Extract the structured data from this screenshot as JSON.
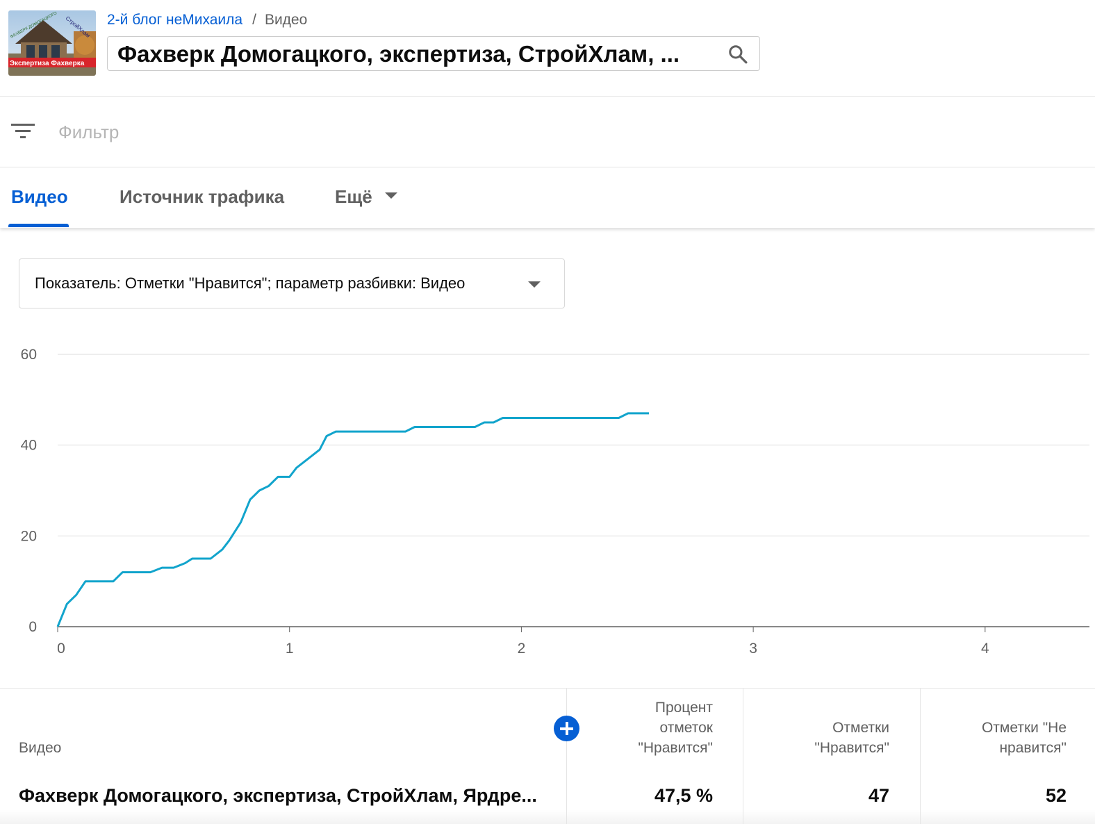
{
  "header": {
    "channel_name": "2-й блог неМихаила",
    "breadcrumb_separator": "/",
    "breadcrumb_current": "Видео",
    "video_title": "Фахверк Домогацкого, экспертиза, СтройХлам, ...",
    "thumbnail": {
      "caption": "Экспертиза Фахверка",
      "logo_text": "СтройХлам",
      "tilted_text": "ФАХВЕРК ДОМОГАЦКОГО"
    }
  },
  "filter": {
    "placeholder": "Фильтр"
  },
  "tabs": {
    "items": [
      {
        "label": "Видео",
        "active": true
      },
      {
        "label": "Источник трафика",
        "active": false
      }
    ],
    "more_label": "Ещё"
  },
  "metric_selector": {
    "label": "Показатель: Отметки \"Нравится\"; параметр разбивки: Видео"
  },
  "chart_data": {
    "type": "line",
    "color": "#12a4cc",
    "x_ticks": [
      "0",
      "1",
      "2",
      "3",
      "4"
    ],
    "y_ticks": [
      "0",
      "20",
      "40",
      "60"
    ],
    "xlim": [
      0,
      4.45
    ],
    "ylim": [
      0,
      60
    ],
    "grid": true,
    "series": [
      {
        "x": [
          0,
          0.04,
          0.08,
          0.12,
          0.24,
          0.28,
          0.4,
          0.45,
          0.5,
          0.55,
          0.58,
          0.66,
          0.71,
          0.74,
          0.79,
          0.83,
          0.87,
          0.91,
          0.95,
          1.0,
          1.03,
          1.08,
          1.13,
          1.16,
          1.2,
          1.5,
          1.54,
          1.8,
          1.84,
          1.88,
          1.92,
          2.42,
          2.46,
          2.55
        ],
        "y": [
          0,
          5,
          7,
          10,
          10,
          12,
          12,
          13,
          13,
          14,
          15,
          15,
          17,
          19,
          23,
          28,
          30,
          31,
          33,
          33,
          35,
          37,
          39,
          42,
          43,
          43,
          44,
          44,
          45,
          45,
          46,
          46,
          47,
          47
        ]
      }
    ]
  },
  "table": {
    "columns": [
      "Видео",
      "Процент отметок \"Нравится\"",
      "Отметки \"Нравится\"",
      "Отметки \"Не нравится\""
    ],
    "rows": [
      {
        "video": "Фахверк Домогацкого, экспертиза, СтройХлам, Ярдре...",
        "like_percent": "47,5 %",
        "likes": "47",
        "dislikes": "52"
      }
    ]
  }
}
